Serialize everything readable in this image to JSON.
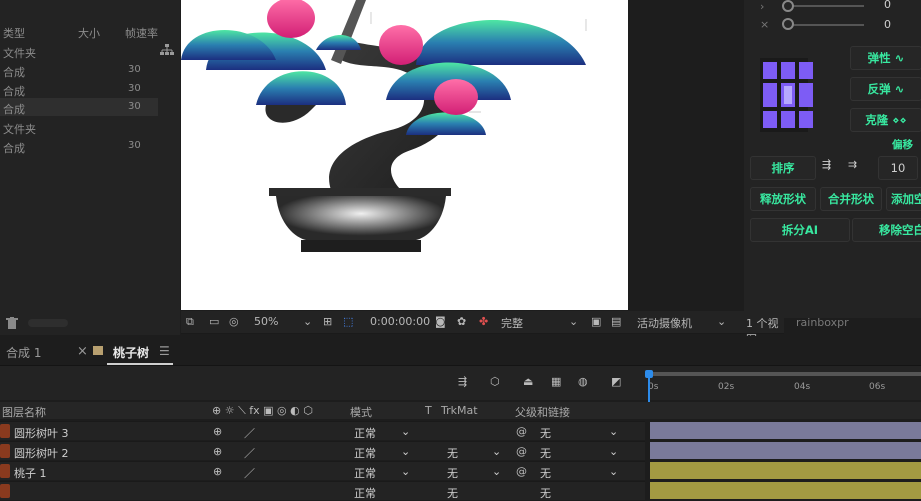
{
  "project": {
    "headers": {
      "type": "类型",
      "size": "大小",
      "fps": "帧速率"
    },
    "rows": [
      {
        "name": "文件夹",
        "fps": ""
      },
      {
        "name": "合成",
        "fps": "30"
      },
      {
        "name": "合成",
        "fps": "30"
      },
      {
        "name": "合成",
        "fps": "30"
      },
      {
        "name": "文件夹",
        "fps": ""
      },
      {
        "name": "合成",
        "fps": "30"
      }
    ]
  },
  "viewer": {
    "zoom": "50%",
    "timecode": "0:00:00:00",
    "quality": "完整",
    "camera": "活动摄像机",
    "views": "1 个视图",
    "panel_label": "rainboxpr"
  },
  "rpanel": {
    "slider_values": [
      "0",
      "0"
    ],
    "buttons": {
      "spring": "弹性",
      "bounce": "反弹",
      "clone": "克隆",
      "offset": "偏移",
      "sort": "排序",
      "sort_value": "10",
      "release_shape": "释放形状",
      "merge_shape": "合并形状",
      "add": "添加空",
      "split_ai": "拆分AI",
      "remove_empty": "移除空白"
    }
  },
  "tabs": {
    "comp1": "合成 1",
    "peach_tree": "桃子树"
  },
  "timeline": {
    "columns": {
      "layer_name": "图层名称",
      "mode": "模式",
      "t": "T",
      "trkmat": "TrkMat",
      "parent": "父级和链接"
    },
    "ruler": [
      "0s",
      "02s",
      "04s",
      "06s"
    ],
    "layers": [
      {
        "name": "圆形树叶 3",
        "mode": "正常",
        "trkmat": "",
        "parent": "无",
        "bar_color": "#7a7a9a"
      },
      {
        "name": "圆形树叶 2",
        "mode": "正常",
        "trkmat": "无",
        "parent": "无",
        "bar_color": "#7a7a9a"
      },
      {
        "name": "桃子 1",
        "mode": "正常",
        "trkmat": "无",
        "parent": "无",
        "bar_color": "#a39a42"
      },
      {
        "name": "",
        "mode": "正常",
        "trkmat": "无",
        "parent": "无",
        "bar_color": "#a39a42"
      }
    ]
  }
}
